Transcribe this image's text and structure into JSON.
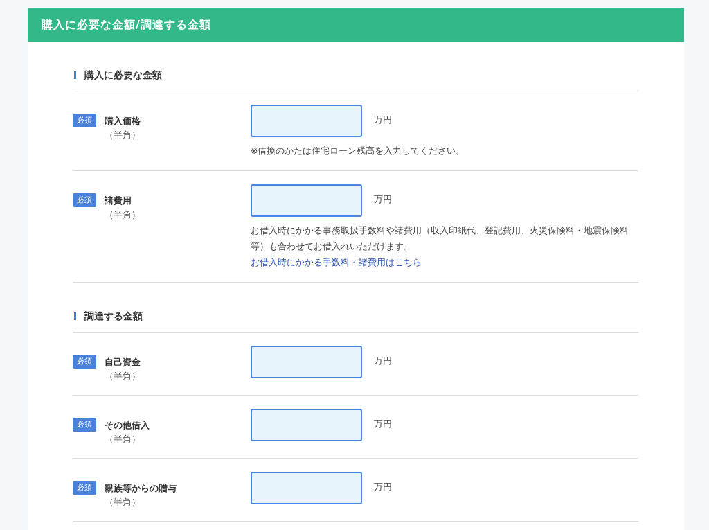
{
  "header": {
    "title": "購入に必要な金額/調達する金額"
  },
  "sections": [
    {
      "heading": "購入に必要な金額",
      "fields": [
        {
          "badge": "必須",
          "label": "購入価格",
          "hint": "（半角）",
          "unit": "万円",
          "notes": [
            "※借換のかたは住宅ローン残高を入力してください。"
          ]
        },
        {
          "badge": "必須",
          "label": "諸費用",
          "hint": "（半角）",
          "unit": "万円",
          "notes": [
            "お借入時にかかる事務取扱手数料や諸費用（収入印紙代、登記費用、火災保険料・地震保険料等）も合わせてお借入れいただけます。"
          ],
          "link": "お借入時にかかる手数料・諸費用はこちら"
        }
      ]
    },
    {
      "heading": "調達する金額",
      "fields": [
        {
          "badge": "必須",
          "label": "自己資金",
          "hint": "（半角）",
          "unit": "万円"
        },
        {
          "badge": "必須",
          "label": "その他借入",
          "hint": "（半角）",
          "unit": "万円"
        },
        {
          "badge": "必須",
          "label": "親族等からの贈与",
          "hint": "（半角）",
          "unit": "万円"
        }
      ]
    }
  ]
}
